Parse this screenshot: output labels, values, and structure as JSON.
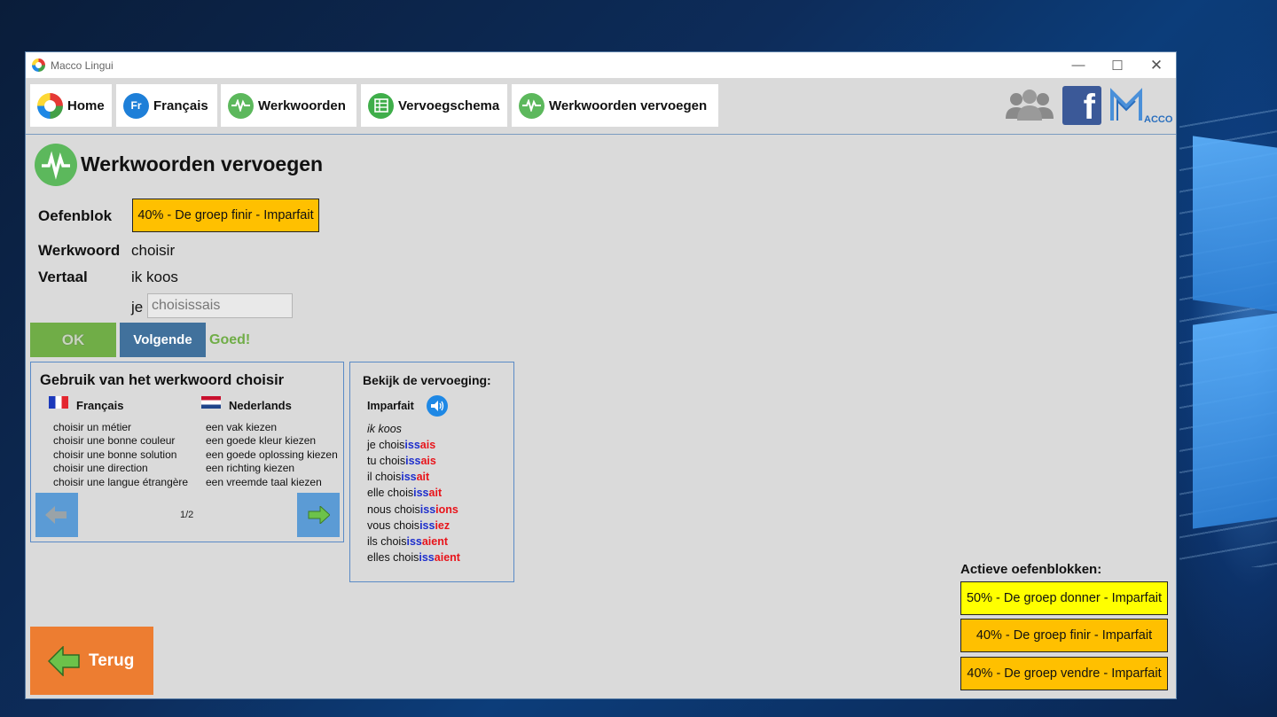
{
  "window": {
    "title": "Macco Lingui"
  },
  "nav": {
    "home": "Home",
    "francais": "Français",
    "werkwoorden": "Werkwoorden",
    "vervoegschema": "Vervoegschema",
    "werkwoorden_vervoegen": "Werkwoorden vervoegen",
    "fr_icon_text": "Fr",
    "macco_text": "ACCO"
  },
  "page": {
    "title": "Werkwoorden vervoegen"
  },
  "exercise": {
    "oefenblok_label": "Oefenblok",
    "oefenblok_value": "40% - De groep finir - Imparfait",
    "werkwoord_label": "Werkwoord",
    "werkwoord_value": "choisir",
    "vertaal_label": "Vertaal",
    "vertaal_value": "ik koos",
    "pronoun": "je",
    "answer_value": "choisissais",
    "ok_label": "OK",
    "next_label": "Volgende",
    "feedback": "Goed!"
  },
  "usage": {
    "title": "Gebruik van het werkwoord choisir",
    "col_fr": "Français",
    "col_nl": "Nederlands",
    "phrases_fr": [
      "choisir un métier",
      "choisir une bonne couleur",
      "choisir une bonne solution",
      "choisir une direction",
      "choisir une langue étrangère"
    ],
    "phrases_nl": [
      "een vak kiezen",
      "een goede kleur kiezen",
      "een goede oplossing kiezen",
      "een richting kiezen",
      "een vreemde taal kiezen"
    ],
    "page_indicator": "1/2"
  },
  "conjugation": {
    "title": "Bekijk de vervoeging:",
    "tense": "Imparfait",
    "translation": "ik koos",
    "lines": [
      {
        "prefix": "je chois",
        "blue": "iss",
        "red": "ais"
      },
      {
        "prefix": "tu chois",
        "blue": "iss",
        "red": "ais"
      },
      {
        "prefix": "il chois",
        "blue": "iss",
        "red": "ait"
      },
      {
        "prefix": "elle chois",
        "blue": "iss",
        "red": "ait"
      },
      {
        "prefix": "nous chois",
        "blue": "iss",
        "red": "ions"
      },
      {
        "prefix": "vous chois",
        "blue": "iss",
        "red": "iez"
      },
      {
        "prefix": "ils chois",
        "blue": "iss",
        "red": "aient"
      },
      {
        "prefix": "elles chois",
        "blue": "iss",
        "red": "aient"
      }
    ]
  },
  "back_button": {
    "label": "Terug"
  },
  "active_blocks": {
    "title": "Actieve oefenblokken:",
    "items": [
      "50% - De groep donner - Imparfait",
      "40% - De groep finir - Imparfait",
      "40% - De groep vendre - Imparfait"
    ]
  },
  "colors": {
    "accent_yellow": "#ffc000",
    "ok_green": "#70ad47",
    "next_blue": "#41719c",
    "back_orange": "#ed7d31",
    "conj_blue": "#1f2fcc",
    "conj_red": "#e8141b"
  }
}
